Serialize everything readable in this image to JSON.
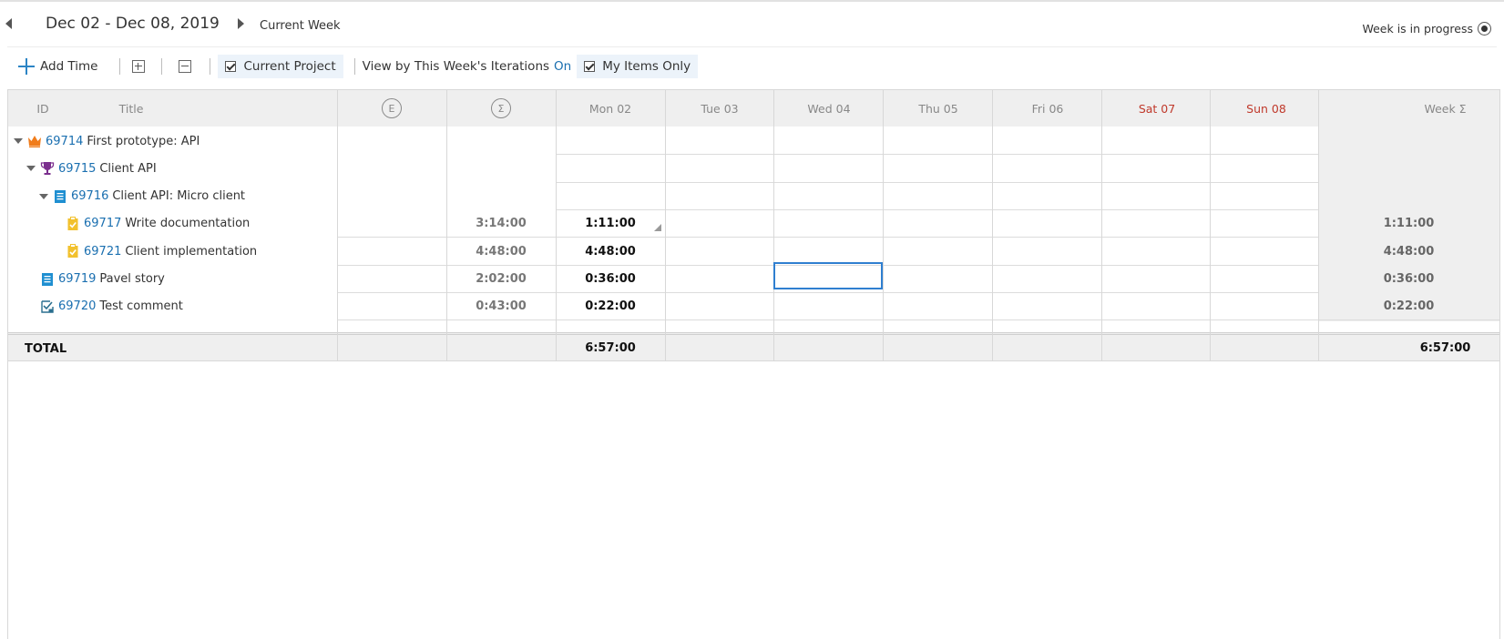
{
  "header": {
    "date_range": "Dec 02 - Dec 08, 2019",
    "current_week_label": "Current Week",
    "week_status": "Week is in progress"
  },
  "toolbar": {
    "add_time_label": "Add Time",
    "current_project_label": "Current Project",
    "view_by_label": "View by This Week's Iterations",
    "view_by_value": "On",
    "my_items_label": "My Items Only"
  },
  "columns": {
    "id": "ID",
    "title": "Title",
    "estimate_symbol": "E",
    "spent_symbol": "Σ",
    "days": [
      {
        "label": "Mon 02",
        "weekend": false
      },
      {
        "label": "Tue 03",
        "weekend": false
      },
      {
        "label": "Wed 04",
        "weekend": false
      },
      {
        "label": "Thu 05",
        "weekend": false
      },
      {
        "label": "Fri 06",
        "weekend": false
      },
      {
        "label": "Sat 07",
        "weekend": true
      },
      {
        "label": "Sun 08",
        "weekend": true
      }
    ],
    "week_total": "Week Σ"
  },
  "rows": [
    {
      "id": "69714",
      "title": "First prototype: API",
      "icon": "crown-icon",
      "icon_color": "#f07c1b",
      "level": 0,
      "expandable": true,
      "spent": "",
      "mon": "",
      "week": ""
    },
    {
      "id": "69715",
      "title": "Client API",
      "icon": "trophy-icon",
      "icon_color": "#7b2f8e",
      "level": 1,
      "expandable": true,
      "spent": "",
      "mon": "",
      "week": ""
    },
    {
      "id": "69716",
      "title": "Client API: Micro client",
      "icon": "story-icon",
      "icon_color": "#1f8fd1",
      "level": 2,
      "expandable": true,
      "spent": "",
      "mon": "",
      "week": ""
    },
    {
      "id": "69717",
      "title": "Write documentation",
      "icon": "task-icon",
      "icon_color": "#f2c12e",
      "level": 3,
      "expandable": false,
      "spent": "3:14:00",
      "mon": "1:11:00",
      "week": "1:11:00"
    },
    {
      "id": "69721",
      "title": "Client implementation",
      "icon": "task-icon",
      "icon_color": "#f2c12e",
      "level": 3,
      "expandable": false,
      "spent": "4:48:00",
      "mon": "4:48:00",
      "week": "4:48:00"
    },
    {
      "id": "69719",
      "title": "Pavel story",
      "icon": "story-icon",
      "icon_color": "#1f8fd1",
      "level": 1,
      "expandable": false,
      "spent": "2:02:00",
      "mon": "0:36:00",
      "week": "0:36:00"
    },
    {
      "id": "69720",
      "title": "Test comment",
      "icon": "test-case-icon",
      "icon_color": "#2a6f8f",
      "level": 1,
      "expandable": false,
      "spent": "0:43:00",
      "mon": "0:22:00",
      "week": "0:22:00"
    }
  ],
  "total": {
    "label": "TOTAL",
    "mon": "6:57:00",
    "week": "6:57:00"
  }
}
